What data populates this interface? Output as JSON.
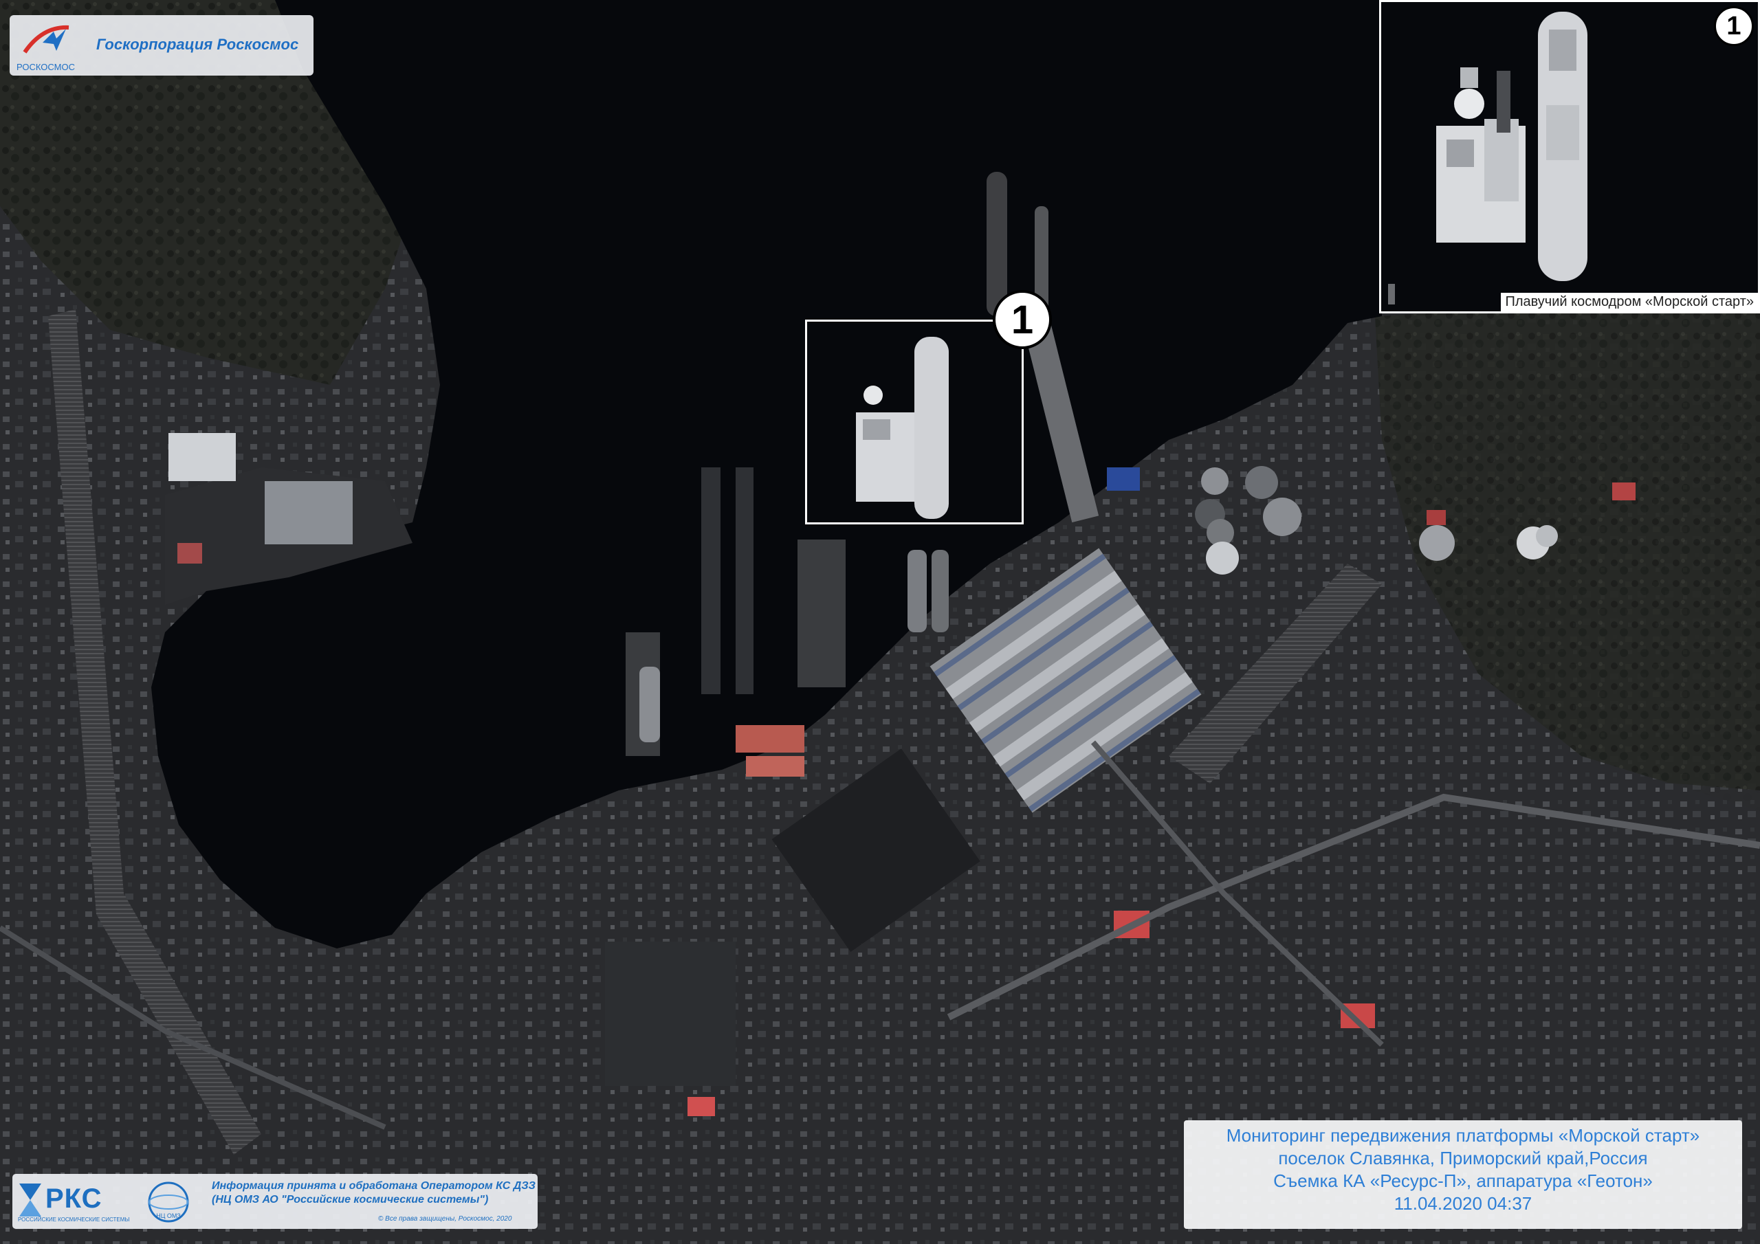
{
  "header": {
    "org_name": "Госкорпорация Роскосмос",
    "logo_label": "РОСКОСМОС"
  },
  "inset": {
    "marker": "1",
    "caption": "Плавучий космодром «Морской старт»"
  },
  "main_marker": "1",
  "caption": {
    "line1": "Мониторинг передвижения платформы «Морской старт»",
    "line2": "поселок Славянка, Приморский край,Россия",
    "line3": "Съемка КА «Ресурс-П», аппаратура «Геотон»",
    "line4": "11.04.2020 04:37"
  },
  "footer": {
    "rks_logo": "РКС",
    "rks_subtitle": "РОССИЙСКИЕ КОСМИЧЕСКИЕ СИСТЕМЫ",
    "omz_logo": "НЦ ОМЗ",
    "info_line1": "Информация принята и обработана Оператором КС ДЗЗ",
    "info_line2": "(НЦ ОМЗ АО \"Российские космические системы\")",
    "copyright": "© Все права защищены, Роскосмос, 2020"
  }
}
